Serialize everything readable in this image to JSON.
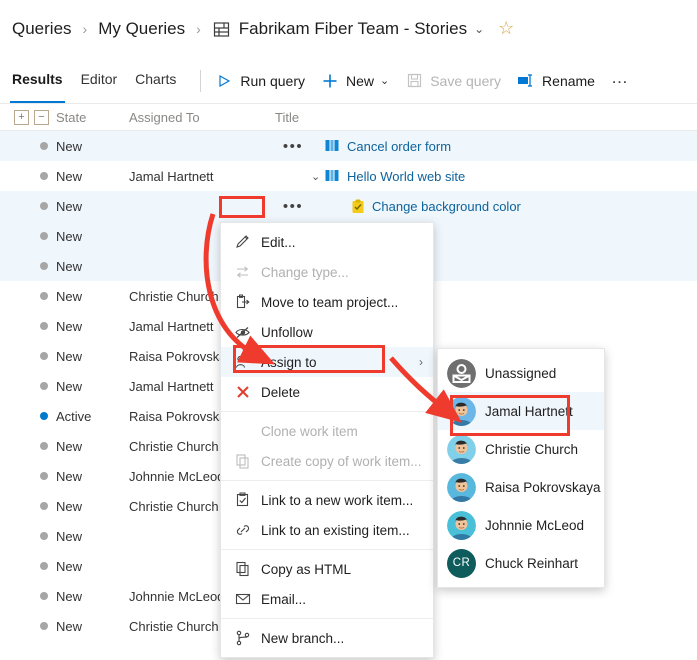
{
  "breadcrumb": {
    "items": [
      {
        "label": "Queries",
        "icon": null
      },
      {
        "label": "My Queries",
        "icon": null
      },
      {
        "label": "Fabrikam Fiber Team - Stories",
        "icon": "query-folder-icon"
      }
    ],
    "separator": "›",
    "dropdown_chevron": "⌄",
    "favorite_icon": "☆"
  },
  "toolbar": {
    "tabs": [
      {
        "label": "Results",
        "active": true
      },
      {
        "label": "Editor",
        "active": false
      },
      {
        "label": "Charts",
        "active": false
      }
    ],
    "buttons": [
      {
        "label": "Run query",
        "icon": "play-icon",
        "disabled": false,
        "chevron": false
      },
      {
        "label": "New",
        "icon": "plus-icon",
        "disabled": false,
        "chevron": true
      },
      {
        "label": "Save query",
        "icon": "save-icon",
        "disabled": true,
        "chevron": false
      },
      {
        "label": "Rename",
        "icon": "rename-icon",
        "disabled": false,
        "chevron": false
      }
    ],
    "overflow_label": "…",
    "chevron": "⌄",
    "accent_color": "#0078d4"
  },
  "grid": {
    "expand_all_label": "+",
    "collapse_all_label": "−",
    "columns": [
      "State",
      "Assigned To",
      "Title"
    ],
    "rows": [
      {
        "state": "New",
        "assigned": "",
        "title": "Cancel order form",
        "icon": "story-icon",
        "indent": 0,
        "chevron": "",
        "selected": true,
        "ctx": true
      },
      {
        "state": "New",
        "assigned": "Jamal Hartnett",
        "title": "Hello World web site",
        "icon": "story-icon",
        "indent": 0,
        "chevron": "⌄",
        "selected": false,
        "ctx": false
      },
      {
        "state": "New",
        "assigned": "",
        "title": "Change background color",
        "icon": "task-icon",
        "indent": 1,
        "chevron": "",
        "selected": true,
        "ctx": true
      },
      {
        "state": "New",
        "assigned": "",
        "title": "",
        "icon": "",
        "indent": 0,
        "chevron": "",
        "selected": true,
        "ctx": false
      },
      {
        "state": "New",
        "assigned": "",
        "title": "",
        "icon": "",
        "indent": 0,
        "chevron": "",
        "selected": true,
        "ctx": false
      },
      {
        "state": "New",
        "assigned": "Christie Church",
        "title": "",
        "icon": "",
        "indent": 0,
        "chevron": "",
        "selected": false,
        "ctx": false
      },
      {
        "state": "New",
        "assigned": "Jamal Hartnett",
        "title": "",
        "icon": "",
        "indent": 0,
        "chevron": "",
        "selected": false,
        "ctx": false
      },
      {
        "state": "New",
        "assigned": "Raisa Pokrovskaya",
        "title": "",
        "icon": "",
        "indent": 0,
        "chevron": "",
        "selected": false,
        "ctx": false
      },
      {
        "state": "New",
        "assigned": "Jamal Hartnett",
        "title": "",
        "icon": "",
        "indent": 0,
        "chevron": "",
        "selected": false,
        "ctx": false
      },
      {
        "state": "Active",
        "assigned": "Raisa Pokrovskaya",
        "title": "",
        "icon": "",
        "indent": 0,
        "chevron": "",
        "selected": false,
        "ctx": false
      },
      {
        "state": "New",
        "assigned": "Christie Church",
        "title": "",
        "icon": "",
        "indent": 0,
        "chevron": "",
        "selected": false,
        "ctx": false
      },
      {
        "state": "New",
        "assigned": "Johnnie McLeod",
        "title": "",
        "icon": "",
        "indent": 0,
        "chevron": "",
        "selected": false,
        "ctx": false
      },
      {
        "state": "New",
        "assigned": "Christie Church",
        "title": "",
        "icon": "",
        "indent": 0,
        "chevron": "",
        "selected": false,
        "ctx": false
      },
      {
        "state": "New",
        "assigned": "",
        "title": "",
        "icon": "",
        "indent": 0,
        "chevron": "",
        "selected": false,
        "ctx": false
      },
      {
        "state": "New",
        "assigned": "",
        "title": "",
        "icon": "",
        "indent": 0,
        "chevron": "",
        "selected": false,
        "ctx": false
      },
      {
        "state": "New",
        "assigned": "Johnnie McLeod",
        "title": "",
        "icon": "",
        "indent": 0,
        "chevron": "",
        "selected": false,
        "ctx": false
      },
      {
        "state": "New",
        "assigned": "Christie Church",
        "title": "",
        "icon": "",
        "indent": 0,
        "chevron": "",
        "selected": false,
        "ctx": false
      }
    ],
    "row_ellipsis": "•••",
    "selected_row_color": "#eff6fc",
    "link_color": "#0e639c"
  },
  "context_menu": {
    "items": [
      {
        "label": "Edit...",
        "icon": "pencil-icon",
        "disabled": false,
        "highlighted": false,
        "submenu": false,
        "sep_after": false
      },
      {
        "label": "Change type...",
        "icon": "change-type-icon",
        "disabled": true,
        "highlighted": false,
        "submenu": false,
        "sep_after": false
      },
      {
        "label": "Move to team project...",
        "icon": "move-icon",
        "disabled": false,
        "highlighted": false,
        "submenu": false,
        "sep_after": false
      },
      {
        "label": "Unfollow",
        "icon": "unfollow-icon",
        "disabled": false,
        "highlighted": false,
        "submenu": false,
        "sep_after": false
      },
      {
        "label": "Assign to",
        "icon": "assign-icon",
        "disabled": false,
        "highlighted": true,
        "submenu": true,
        "sep_after": false
      },
      {
        "label": "Delete",
        "icon": "delete-icon",
        "disabled": false,
        "highlighted": false,
        "submenu": false,
        "sep_after": true
      },
      {
        "label": "Clone work item",
        "icon": "",
        "disabled": true,
        "highlighted": false,
        "submenu": false,
        "sep_after": false
      },
      {
        "label": "Create copy of work item...",
        "icon": "copy-icon",
        "disabled": true,
        "highlighted": false,
        "submenu": false,
        "sep_after": true
      },
      {
        "label": "Link to a new work item...",
        "icon": "link-new-icon",
        "disabled": false,
        "highlighted": false,
        "submenu": false,
        "sep_after": false
      },
      {
        "label": "Link to an existing item...",
        "icon": "link-existing-icon",
        "disabled": false,
        "highlighted": false,
        "submenu": false,
        "sep_after": true
      },
      {
        "label": "Copy as HTML",
        "icon": "copy-html-icon",
        "disabled": false,
        "highlighted": false,
        "submenu": false,
        "sep_after": false
      },
      {
        "label": "Email...",
        "icon": "email-icon",
        "disabled": false,
        "highlighted": false,
        "submenu": false,
        "sep_after": true
      },
      {
        "label": "New branch...",
        "icon": "branch-icon",
        "disabled": false,
        "highlighted": false,
        "submenu": false,
        "sep_after": false
      }
    ],
    "submenu_arrow": "›"
  },
  "assign_submenu": {
    "items": [
      {
        "label": "Unassigned",
        "avatar": "unassigned-avatar",
        "highlighted": false,
        "initials": "",
        "color": "#707070"
      },
      {
        "label": "Jamal Hartnett",
        "avatar": "person-avatar",
        "highlighted": true,
        "initials": "",
        "color": "#6cb6e8"
      },
      {
        "label": "Christie Church",
        "avatar": "person-avatar",
        "highlighted": false,
        "initials": "",
        "color": "#7fd0e8"
      },
      {
        "label": "Raisa Pokrovskaya",
        "avatar": "person-avatar",
        "highlighted": false,
        "initials": "",
        "color": "#58b8de"
      },
      {
        "label": "Johnnie McLeod",
        "avatar": "person-avatar",
        "highlighted": false,
        "initials": "",
        "color": "#49c0d8"
      },
      {
        "label": "Chuck Reinhart",
        "avatar": "initials-avatar",
        "highlighted": false,
        "initials": "CR",
        "color": "#0e5c5c"
      }
    ]
  },
  "annotations": {
    "highlight_color": "#ef3b2d",
    "boxes": [
      {
        "name": "row-context-button-highlight"
      },
      {
        "name": "assign-to-highlight"
      },
      {
        "name": "jamal-hartnett-highlight"
      }
    ],
    "arrows": [
      {
        "name": "arrow-context-to-assign"
      },
      {
        "name": "arrow-assign-to-person"
      }
    ]
  }
}
